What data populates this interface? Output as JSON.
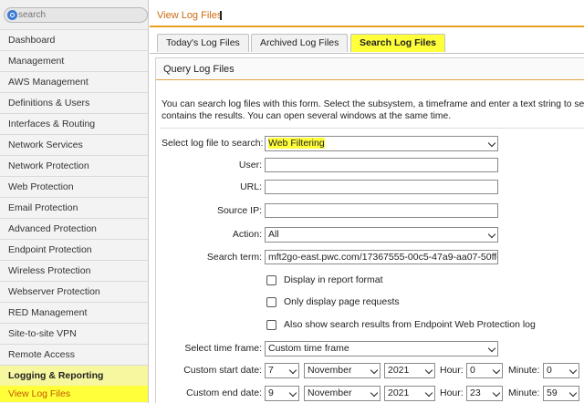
{
  "sidebar": {
    "search_placeholder": "search",
    "items": [
      "Dashboard",
      "Management",
      "AWS Management",
      "Definitions & Users",
      "Interfaces & Routing",
      "Network Services",
      "Network Protection",
      "Web Protection",
      "Email Protection",
      "Advanced Protection",
      "Endpoint Protection",
      "Wireless Protection",
      "Webserver Protection",
      "RED Management",
      "Site-to-site VPN",
      "Remote Access",
      "Logging & Reporting"
    ],
    "active_item": "Logging & Reporting",
    "sub_item": "View Log Files"
  },
  "header": {
    "title": "View Log Files"
  },
  "tabs": [
    "Today's Log Files",
    "Archived Log Files",
    "Search Log Files"
  ],
  "panel": {
    "title": "Query Log Files",
    "description_line1": "You can search log files with this form. Select the subsystem, a timeframe and enter a text string to se",
    "description_line2": "contains the results. You can open several windows at the same time."
  },
  "form": {
    "log_file_label": "Select log file to search:",
    "log_file_value": "Web Filtering",
    "user_label": "User:",
    "user_value": "",
    "url_label": "URL:",
    "url_value": "",
    "source_ip_label": "Source IP:",
    "source_ip_value": "",
    "action_label": "Action:",
    "action_value": "All",
    "search_term_label": "Search term:",
    "search_term_value": "mft2go-east.pwc.com/17367555-00c5-47a9-aa07-50ffc",
    "checkbox_report": "Display in report format",
    "checkbox_page_requests": "Only display page requests",
    "checkbox_endpoint": "Also show search results from Endpoint Web Protection log",
    "time_frame_label": "Select time frame:",
    "time_frame_value": "Custom time frame",
    "start_label": "Custom start date:",
    "start_day": "7",
    "start_month": "November",
    "start_year": "2021",
    "hour_label": "Hour:",
    "minute_label": "Minute:",
    "start_hour": "0",
    "start_minute": "0",
    "end_label": "Custom end date:",
    "end_day": "9",
    "end_month": "November",
    "end_year": "2021",
    "end_hour": "23",
    "end_minute": "59"
  }
}
